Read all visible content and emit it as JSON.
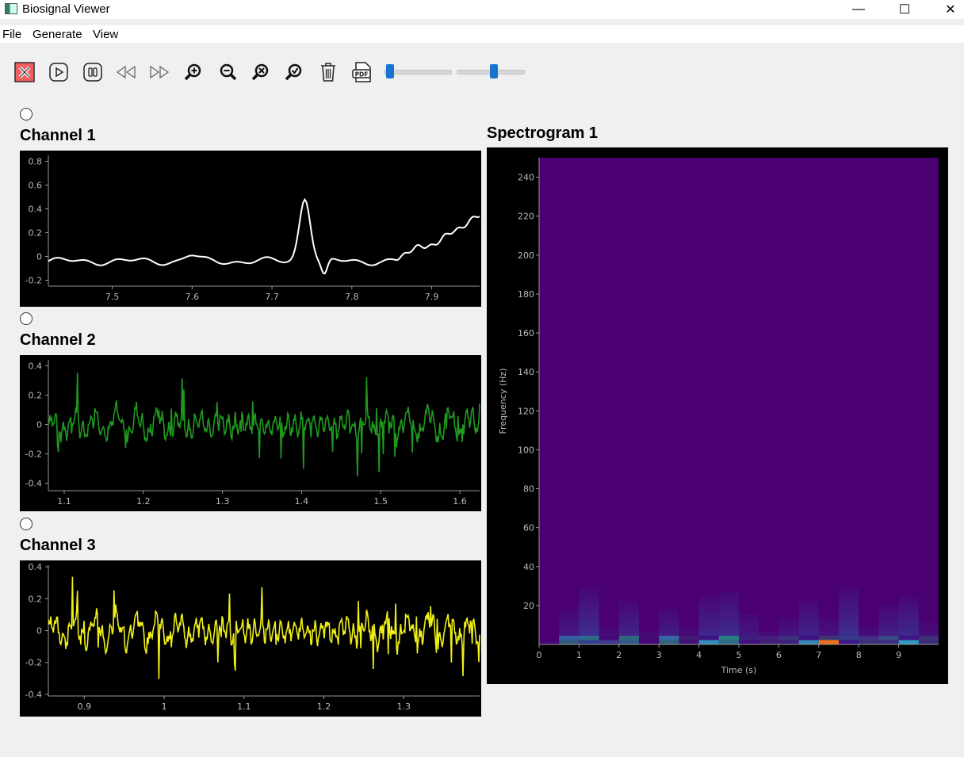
{
  "window": {
    "title": "Biosignal Viewer",
    "minimize": "—",
    "maximize": "☐",
    "close": "✕"
  },
  "menu": [
    "File",
    "Generate",
    "View"
  ],
  "toolbar": {
    "icons": [
      "stop-icon",
      "play-icon",
      "pause-icon",
      "rewind-icon",
      "fast-forward-icon",
      "zoom-in-icon",
      "zoom-out-icon",
      "zoom-reset-icon",
      "zoom-fit-icon",
      "trash-icon",
      "pdf-icon"
    ],
    "pdf_label": "PDF",
    "slider1_value": 0.03,
    "slider2_value": 0.55
  },
  "channels": [
    {
      "title": "Channel 1",
      "color": "#ffffff",
      "xlim": [
        7.42,
        7.96
      ],
      "ylim": [
        -0.25,
        0.85
      ],
      "yticks": [
        -0.2,
        0,
        0.2,
        0.4,
        0.6,
        0.8
      ],
      "xticks": [
        7.5,
        7.6,
        7.7,
        7.8,
        7.9
      ],
      "signal": {
        "type": "ecg_segment"
      }
    },
    {
      "title": "Channel 2",
      "color": "#1f9a1f",
      "xlim": [
        1.08,
        1.625
      ],
      "ylim": [
        -0.45,
        0.44
      ],
      "yticks": [
        -0.4,
        -0.2,
        0,
        0.2,
        0.4
      ],
      "xticks": [
        1.1,
        1.2,
        1.3,
        1.4,
        1.5,
        1.6
      ],
      "signal": {
        "type": "noisy_oscillation"
      }
    },
    {
      "title": "Channel 3",
      "color": "#f0f018",
      "xlim": [
        0.855,
        1.395
      ],
      "ylim": [
        -0.41,
        0.41
      ],
      "yticks": [
        -0.4,
        -0.2,
        0,
        0.2,
        0.4
      ],
      "xticks": [
        0.9,
        1.0,
        1.1,
        1.2,
        1.3
      ],
      "signal": {
        "type": "noisy_oscillation"
      }
    }
  ],
  "spectrogram": {
    "title": "Spectrogram 1",
    "xlabel": "Time (s)",
    "ylabel": "Frequency (Hz)",
    "xlim": [
      0,
      10
    ],
    "ylim": [
      0,
      250
    ],
    "xticks": [
      0,
      1,
      2,
      3,
      4,
      5,
      6,
      7,
      8,
      9
    ],
    "yticks": [
      20,
      40,
      60,
      80,
      100,
      120,
      140,
      160,
      180,
      200,
      220,
      240
    ],
    "background_color": "#4a0070",
    "activity": [
      0.1,
      0.55,
      0.9,
      0.3,
      0.7,
      0.2,
      0.6,
      0.25,
      0.75,
      0.85,
      0.5,
      0.2,
      0.45,
      0.7,
      0.4,
      0.9,
      0.3,
      0.65,
      0.8,
      0.35
    ]
  }
}
